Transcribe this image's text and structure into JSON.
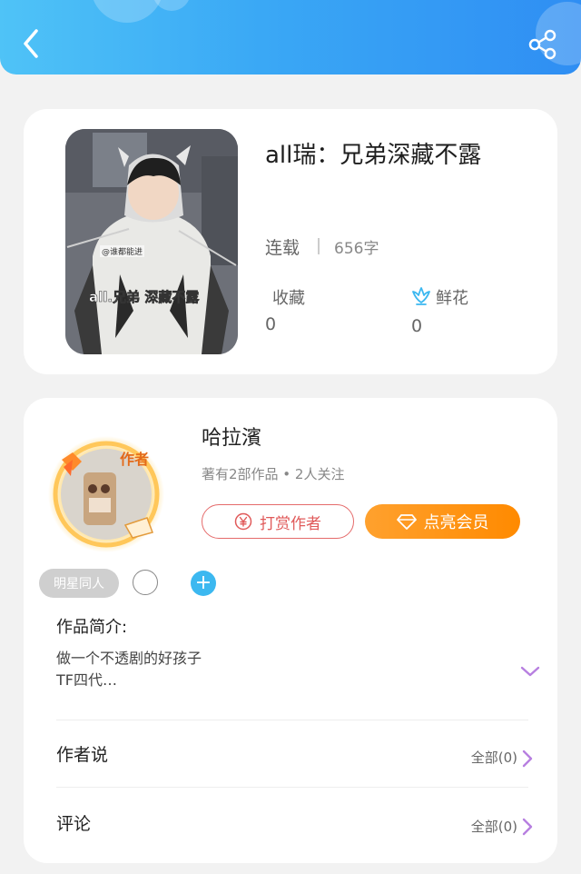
{
  "header": {
    "back_icon": "chevron-left-icon",
    "share_icon": "share-icon"
  },
  "book": {
    "title": "all瑞：兄弟深藏不露",
    "status": "连载",
    "word_count": "656字",
    "cover_caption": "all.兄弟 深藏不露",
    "cover_watermark": "@谁都能进",
    "collect_label": "收藏",
    "collect_count": "0",
    "flower_label": "鲜花",
    "flower_count": "0"
  },
  "author": {
    "name": "哈拉濱",
    "badge": "作者",
    "meta": "著有2部作品 • 2人关注",
    "tip_button": "打赏作者",
    "vip_button": "点亮会员",
    "tag": "明星同人"
  },
  "intro": {
    "heading": "作品简介:",
    "line1": "做一个不透剧的好孩子",
    "line2": "TF四代…"
  },
  "author_says": {
    "heading": "作者说",
    "all_label": "全部(0)"
  },
  "comments": {
    "heading": "评论",
    "all_label": "全部(0)"
  },
  "colors": {
    "header_start": "#4fc3f7",
    "header_end": "#2f8ef3",
    "vip": "#ff8a00",
    "tip": "#e05a5a",
    "arrow": "#b77fe0"
  }
}
